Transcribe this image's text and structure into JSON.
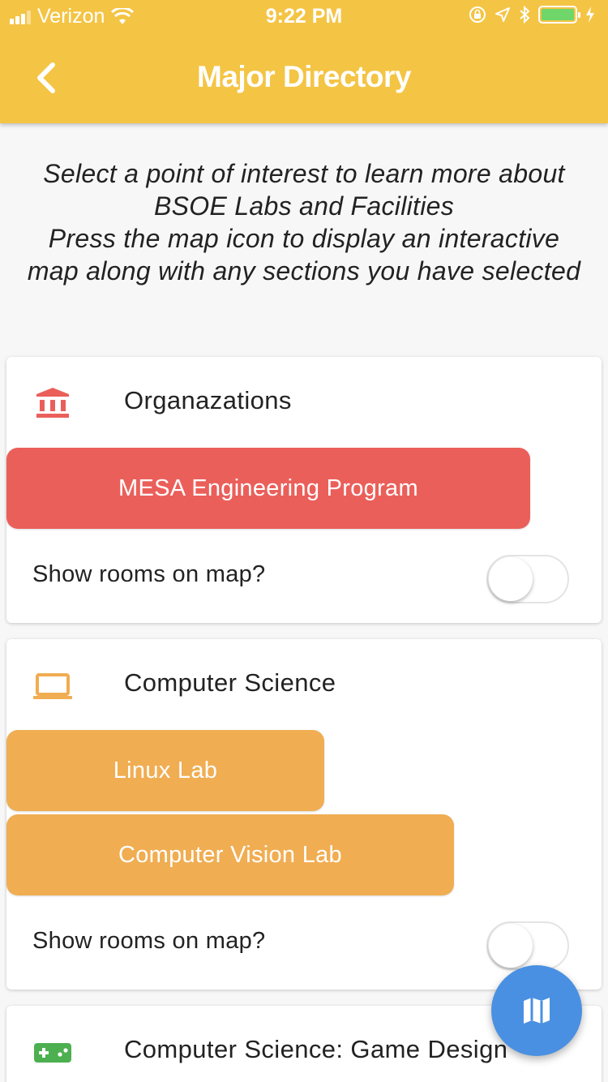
{
  "status_bar": {
    "carrier": "Verizon",
    "time": "9:22 PM"
  },
  "header": {
    "title": "Major Directory"
  },
  "intro": {
    "lines": [
      "Select a point of interest to learn more about",
      "BSOE Labs and Facilities",
      "Press the map icon to display an interactive",
      "map along with any sections you have selected"
    ]
  },
  "sections": [
    {
      "title": "Organazations",
      "icon": "institution-icon",
      "color": "#eb5f5a",
      "items": [
        "MESA Engineering Program"
      ],
      "toggle_label": "Show rooms on map?",
      "toggle_on": false
    },
    {
      "title": "Computer Science",
      "icon": "laptop-icon",
      "color": "#f0ad52",
      "items": [
        "Linux Lab",
        "Computer Vision Lab"
      ],
      "toggle_label": "Show rooms on map?",
      "toggle_on": false
    },
    {
      "title": "Computer Science: Game Design",
      "icon": "gamepad-icon",
      "color": "#4caf50"
    }
  ],
  "fab": {
    "icon": "map-icon",
    "color": "#4a90e2"
  }
}
